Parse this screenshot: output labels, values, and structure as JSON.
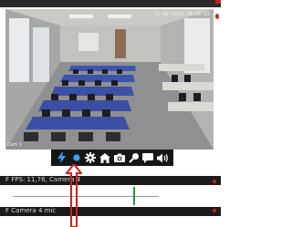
{
  "camera": {
    "timestamp": "21-06-2019 10:36:03",
    "name": "Cam 1"
  },
  "toolbar": {
    "buttons": [
      {
        "icon": "lightning-icon",
        "color": "#3aa0ff"
      },
      {
        "icon": "record-dot-icon",
        "color": "#3aa0ff"
      },
      {
        "icon": "gear-icon",
        "color": "#ffffff"
      },
      {
        "icon": "home-icon",
        "color": "#ffffff"
      },
      {
        "icon": "camera-icon",
        "color": "#ffffff"
      },
      {
        "icon": "zoom-icon",
        "color": "#ffffff"
      },
      {
        "icon": "chat-icon",
        "color": "#ffffff"
      },
      {
        "icon": "speaker-icon",
        "color": "#ffffff"
      }
    ]
  },
  "panels": [
    {
      "label": "F  FPS: 11,76, Camera 4"
    },
    {
      "label": "F  Camera 4 mic"
    }
  ],
  "colors": {
    "accent": "#3aa0ff",
    "annotation": "#d21e1e",
    "level": "#1f9d33"
  }
}
